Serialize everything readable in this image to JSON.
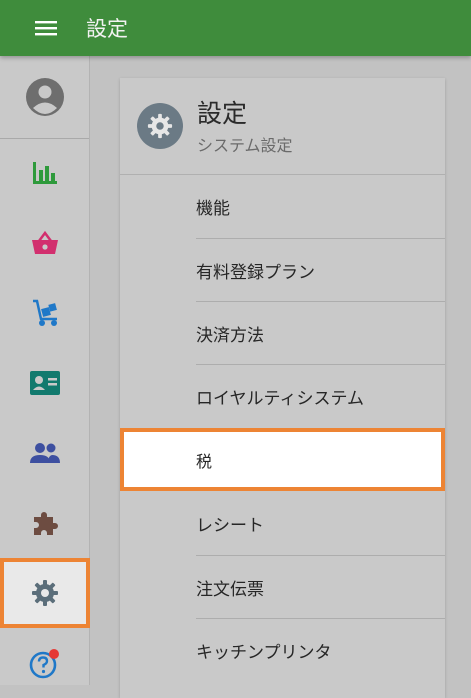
{
  "appbar": {
    "title": "設定",
    "menu_icon": "hamburger-menu-icon"
  },
  "sidebar": {
    "items": [
      {
        "key": "account",
        "icon": "account-circle-icon",
        "color": "#6e6e6e"
      },
      {
        "key": "reports",
        "icon": "bar-chart-icon",
        "color": "#2e9a3b"
      },
      {
        "key": "sales",
        "icon": "shopping-basket-icon",
        "color": "#d22f6e"
      },
      {
        "key": "inventory",
        "icon": "hand-truck-icon",
        "color": "#1f78c8"
      },
      {
        "key": "customers",
        "icon": "contact-card-icon",
        "color": "#127a6e"
      },
      {
        "key": "employees",
        "icon": "people-icon",
        "color": "#3d4fa0"
      },
      {
        "key": "plugins",
        "icon": "puzzle-piece-icon",
        "color": "#6d4c41"
      },
      {
        "key": "settings",
        "icon": "gear-icon",
        "color": "#5b6e7a",
        "active": true
      },
      {
        "key": "help",
        "icon": "help-circle-icon",
        "color": "#1f78c8",
        "badge_color": "#e53935"
      }
    ]
  },
  "settings_card": {
    "title": "設定",
    "subtitle": "システム設定",
    "icon": "gear-icon",
    "items": [
      {
        "label": "機能"
      },
      {
        "label": "有料登録プラン"
      },
      {
        "label": "決済方法"
      },
      {
        "label": "ロイヤルティシステム"
      },
      {
        "label": "税",
        "selected": true
      },
      {
        "label": "レシート"
      },
      {
        "label": "注文伝票"
      },
      {
        "label": "キッチンプリンタ"
      }
    ]
  },
  "colors": {
    "appbar": "#3f8c3c",
    "highlight": "#ed8434",
    "background": "#c2c2c2"
  }
}
